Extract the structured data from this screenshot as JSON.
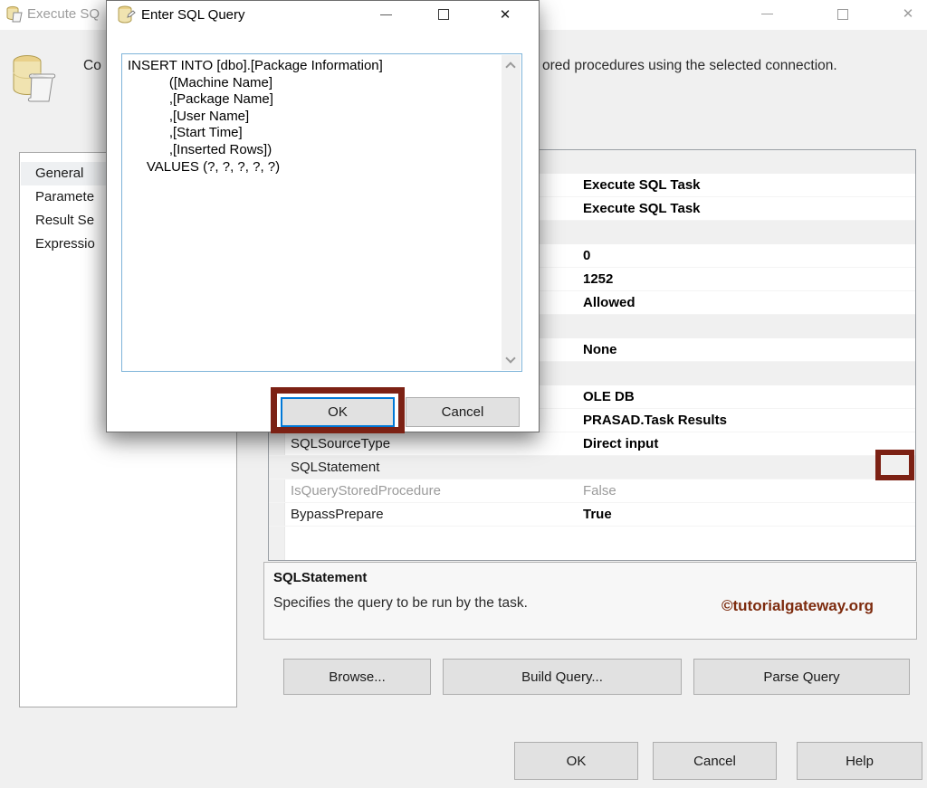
{
  "colors": {
    "annotation": "#7c2114",
    "watermark": "#7d2b0e",
    "accent_blue": "#0078d7",
    "category_gray": "#f0f0f0",
    "button_gray": "#e1e1e1"
  },
  "background_window": {
    "title": "Execute SQ",
    "description": {
      "left_fragment": "Co",
      "right_fragment": "ored procedures using the selected connection."
    },
    "sidebar": {
      "items": [
        {
          "label": "General",
          "selected": true
        },
        {
          "label": "Paramete",
          "selected": false
        },
        {
          "label": "Result Se",
          "selected": false
        },
        {
          "label": "Expressio",
          "selected": false
        }
      ]
    },
    "property_grid": {
      "rows": [
        {
          "type": "category",
          "label": "",
          "value": ""
        },
        {
          "type": "item",
          "label": "",
          "value": "Execute SQL Task"
        },
        {
          "type": "item",
          "label": "",
          "value": "Execute SQL Task"
        },
        {
          "type": "category",
          "label": "",
          "value": ""
        },
        {
          "type": "item",
          "label": "",
          "value": "0"
        },
        {
          "type": "item",
          "label": "",
          "value": "1252"
        },
        {
          "type": "item",
          "label": "",
          "value": "Allowed"
        },
        {
          "type": "category",
          "label": "",
          "value": ""
        },
        {
          "type": "item",
          "label": "",
          "value": "None"
        },
        {
          "type": "category",
          "label": "",
          "value": ""
        },
        {
          "type": "item",
          "label": "",
          "value": "OLE DB"
        },
        {
          "type": "item",
          "label": "",
          "value": "PRASAD.Task Results"
        },
        {
          "type": "item",
          "label": "SQLSourceType",
          "value": "Direct input"
        },
        {
          "type": "item",
          "label": "SQLStatement",
          "value": "",
          "selected": true
        },
        {
          "type": "item",
          "label": "IsQueryStoredProcedure",
          "value": "False",
          "disabled": true
        },
        {
          "type": "item",
          "label": "BypassPrepare",
          "value": "True"
        }
      ]
    },
    "help_panel": {
      "property": "SQLStatement",
      "description": "Specifies the query to be run by the task.",
      "watermark": "©tutorialgateway.org"
    },
    "buttons": {
      "browse": "Browse...",
      "build_query": "Build Query...",
      "parse_query": "Parse Query",
      "ok": "OK",
      "cancel": "Cancel",
      "help": "Help"
    }
  },
  "modal": {
    "title": "Enter SQL Query",
    "sql_text": "INSERT INTO [dbo].[Package Information]\n           ([Machine Name]\n           ,[Package Name]\n           ,[User Name]\n           ,[Start Time]\n           ,[Inserted Rows])\n     VALUES (?, ?, ?, ?, ?)",
    "buttons": {
      "ok": "OK",
      "cancel": "Cancel"
    }
  }
}
